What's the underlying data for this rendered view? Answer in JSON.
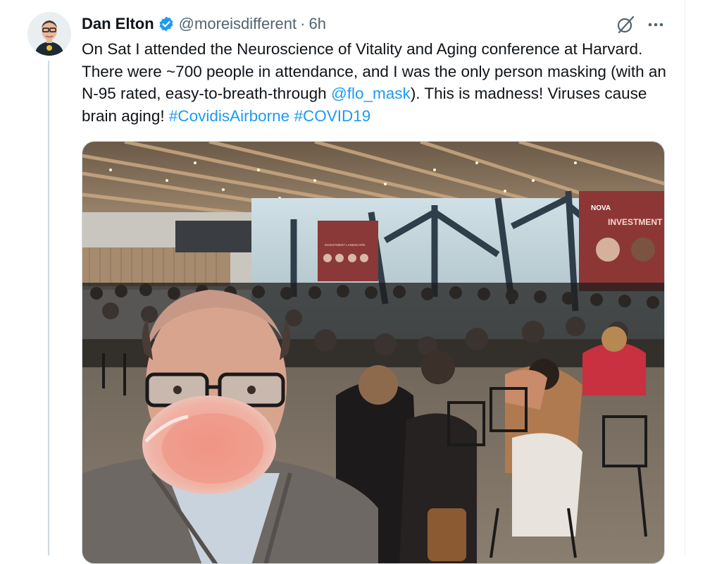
{
  "tweet": {
    "author_name": "Dan Elton",
    "handle": "@moreisdifferent",
    "separator": "·",
    "time": "6h",
    "text_1": "On Sat I attended the Neuroscience of Vitality and Aging conference at Harvard. There were ~700 people in attendance, and I was the only person masking (with an N-95 rated, easy-to-breath-through ",
    "mention": "@flo_mask",
    "text_2": "). This is madness! Viruses cause brain aging! ",
    "hashtag_1": "#CovidisAirborne",
    "hashtag_2": "#COVID19"
  },
  "media": {
    "screen_right_logo": "NOVA",
    "screen_right_title": "INVESTMENT",
    "screen_left_title": "INVESTMENT LANDSCAPE"
  },
  "icons": {
    "verified": "verified-badge-icon",
    "grok": "grok-icon",
    "more": "more-icon"
  },
  "colors": {
    "link": "#1d9bf0",
    "verified": "#1d9bf0",
    "text": "#0f1419",
    "secondary": "#536471"
  }
}
